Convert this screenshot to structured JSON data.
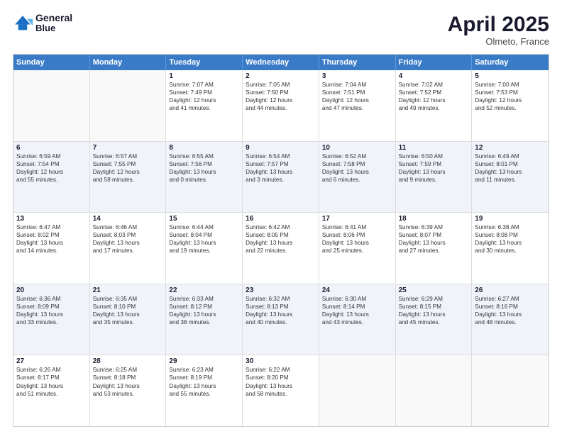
{
  "logo": {
    "line1": "General",
    "line2": "Blue"
  },
  "title": {
    "month_year": "April 2025",
    "location": "Olmeto, France"
  },
  "header_days": [
    "Sunday",
    "Monday",
    "Tuesday",
    "Wednesday",
    "Thursday",
    "Friday",
    "Saturday"
  ],
  "rows": [
    [
      {
        "day": "",
        "lines": []
      },
      {
        "day": "",
        "lines": []
      },
      {
        "day": "1",
        "lines": [
          "Sunrise: 7:07 AM",
          "Sunset: 7:49 PM",
          "Daylight: 12 hours",
          "and 41 minutes."
        ]
      },
      {
        "day": "2",
        "lines": [
          "Sunrise: 7:05 AM",
          "Sunset: 7:50 PM",
          "Daylight: 12 hours",
          "and 44 minutes."
        ]
      },
      {
        "day": "3",
        "lines": [
          "Sunrise: 7:04 AM",
          "Sunset: 7:51 PM",
          "Daylight: 12 hours",
          "and 47 minutes."
        ]
      },
      {
        "day": "4",
        "lines": [
          "Sunrise: 7:02 AM",
          "Sunset: 7:52 PM",
          "Daylight: 12 hours",
          "and 49 minutes."
        ]
      },
      {
        "day": "5",
        "lines": [
          "Sunrise: 7:00 AM",
          "Sunset: 7:53 PM",
          "Daylight: 12 hours",
          "and 52 minutes."
        ]
      }
    ],
    [
      {
        "day": "6",
        "lines": [
          "Sunrise: 6:59 AM",
          "Sunset: 7:54 PM",
          "Daylight: 12 hours",
          "and 55 minutes."
        ]
      },
      {
        "day": "7",
        "lines": [
          "Sunrise: 6:57 AM",
          "Sunset: 7:55 PM",
          "Daylight: 12 hours",
          "and 58 minutes."
        ]
      },
      {
        "day": "8",
        "lines": [
          "Sunrise: 6:55 AM",
          "Sunset: 7:56 PM",
          "Daylight: 13 hours",
          "and 0 minutes."
        ]
      },
      {
        "day": "9",
        "lines": [
          "Sunrise: 6:54 AM",
          "Sunset: 7:57 PM",
          "Daylight: 13 hours",
          "and 3 minutes."
        ]
      },
      {
        "day": "10",
        "lines": [
          "Sunrise: 6:52 AM",
          "Sunset: 7:58 PM",
          "Daylight: 13 hours",
          "and 6 minutes."
        ]
      },
      {
        "day": "11",
        "lines": [
          "Sunrise: 6:50 AM",
          "Sunset: 7:59 PM",
          "Daylight: 13 hours",
          "and 9 minutes."
        ]
      },
      {
        "day": "12",
        "lines": [
          "Sunrise: 6:49 AM",
          "Sunset: 8:01 PM",
          "Daylight: 13 hours",
          "and 11 minutes."
        ]
      }
    ],
    [
      {
        "day": "13",
        "lines": [
          "Sunrise: 6:47 AM",
          "Sunset: 8:02 PM",
          "Daylight: 13 hours",
          "and 14 minutes."
        ]
      },
      {
        "day": "14",
        "lines": [
          "Sunrise: 6:46 AM",
          "Sunset: 8:03 PM",
          "Daylight: 13 hours",
          "and 17 minutes."
        ]
      },
      {
        "day": "15",
        "lines": [
          "Sunrise: 6:44 AM",
          "Sunset: 8:04 PM",
          "Daylight: 13 hours",
          "and 19 minutes."
        ]
      },
      {
        "day": "16",
        "lines": [
          "Sunrise: 6:42 AM",
          "Sunset: 8:05 PM",
          "Daylight: 13 hours",
          "and 22 minutes."
        ]
      },
      {
        "day": "17",
        "lines": [
          "Sunrise: 6:41 AM",
          "Sunset: 8:06 PM",
          "Daylight: 13 hours",
          "and 25 minutes."
        ]
      },
      {
        "day": "18",
        "lines": [
          "Sunrise: 6:39 AM",
          "Sunset: 8:07 PM",
          "Daylight: 13 hours",
          "and 27 minutes."
        ]
      },
      {
        "day": "19",
        "lines": [
          "Sunrise: 6:38 AM",
          "Sunset: 8:08 PM",
          "Daylight: 13 hours",
          "and 30 minutes."
        ]
      }
    ],
    [
      {
        "day": "20",
        "lines": [
          "Sunrise: 6:36 AM",
          "Sunset: 8:09 PM",
          "Daylight: 13 hours",
          "and 33 minutes."
        ]
      },
      {
        "day": "21",
        "lines": [
          "Sunrise: 6:35 AM",
          "Sunset: 8:10 PM",
          "Daylight: 13 hours",
          "and 35 minutes."
        ]
      },
      {
        "day": "22",
        "lines": [
          "Sunrise: 6:33 AM",
          "Sunset: 8:12 PM",
          "Daylight: 13 hours",
          "and 38 minutes."
        ]
      },
      {
        "day": "23",
        "lines": [
          "Sunrise: 6:32 AM",
          "Sunset: 8:13 PM",
          "Daylight: 13 hours",
          "and 40 minutes."
        ]
      },
      {
        "day": "24",
        "lines": [
          "Sunrise: 6:30 AM",
          "Sunset: 8:14 PM",
          "Daylight: 13 hours",
          "and 43 minutes."
        ]
      },
      {
        "day": "25",
        "lines": [
          "Sunrise: 6:29 AM",
          "Sunset: 8:15 PM",
          "Daylight: 13 hours",
          "and 45 minutes."
        ]
      },
      {
        "day": "26",
        "lines": [
          "Sunrise: 6:27 AM",
          "Sunset: 8:16 PM",
          "Daylight: 13 hours",
          "and 48 minutes."
        ]
      }
    ],
    [
      {
        "day": "27",
        "lines": [
          "Sunrise: 6:26 AM",
          "Sunset: 8:17 PM",
          "Daylight: 13 hours",
          "and 51 minutes."
        ]
      },
      {
        "day": "28",
        "lines": [
          "Sunrise: 6:25 AM",
          "Sunset: 8:18 PM",
          "Daylight: 13 hours",
          "and 53 minutes."
        ]
      },
      {
        "day": "29",
        "lines": [
          "Sunrise: 6:23 AM",
          "Sunset: 8:19 PM",
          "Daylight: 13 hours",
          "and 55 minutes."
        ]
      },
      {
        "day": "30",
        "lines": [
          "Sunrise: 6:22 AM",
          "Sunset: 8:20 PM",
          "Daylight: 13 hours",
          "and 58 minutes."
        ]
      },
      {
        "day": "",
        "lines": []
      },
      {
        "day": "",
        "lines": []
      },
      {
        "day": "",
        "lines": []
      }
    ]
  ]
}
